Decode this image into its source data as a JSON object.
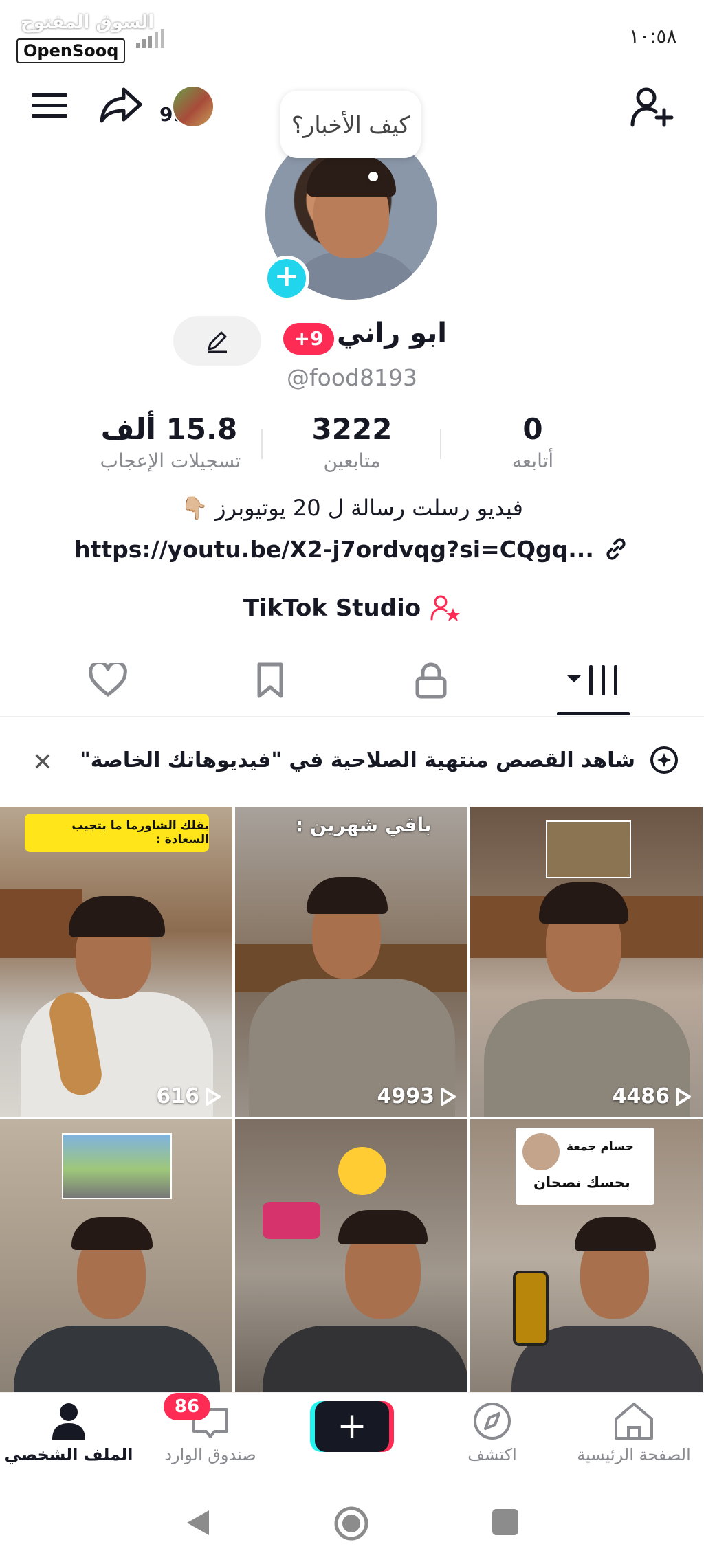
{
  "status_bar": {
    "time": "١٠:٥٨",
    "watermark_ar": "السوق المفتوح",
    "watermark": "OpenSooq"
  },
  "header": {
    "friends_count": "99"
  },
  "profile": {
    "bubble_text": "كيف الأخبار؟",
    "name": "ابو راني",
    "name_badge": "+9",
    "username": "@food8193",
    "stats": [
      {
        "value": "0",
        "label": "أتابعه"
      },
      {
        "value": "3222",
        "label": "متابعين"
      },
      {
        "value": "15.8 ألف",
        "label": "تسجيلات الإعجاب"
      }
    ],
    "bio": "فيديو رسلت رسالة ل 20 يوتيوبرز 👇🏼",
    "link": "https://youtu.be/X2-j7ordvqg?si=CQgq...",
    "studio": "TikTok Studio"
  },
  "banner": {
    "text": "شاهد القصص منتهية الصلاحية في \"فيديوهاتك الخاصة\""
  },
  "videos": [
    {
      "views": "4486",
      "sticker": ""
    },
    {
      "views": "4993",
      "sticker": "باقي شهرين :"
    },
    {
      "views": "616",
      "sticker": "بقلك الشاورما ما بتجيب السعادة :"
    },
    {
      "views": "",
      "sticker_name": "حسام جمعة",
      "sticker": "بحسك نصحان"
    },
    {
      "views": "",
      "sticker": ""
    },
    {
      "views": "",
      "sticker": ""
    }
  ],
  "bottom_nav": {
    "items": [
      {
        "label": "الصفحة الرئيسية",
        "icon": "home-icon"
      },
      {
        "label": "اكتشف",
        "icon": "compass-icon"
      },
      {
        "label": "",
        "icon": "plus-icon"
      },
      {
        "label": "صندوق الوارد",
        "icon": "inbox-icon"
      },
      {
        "label": "الملف الشخصي",
        "icon": "profile-icon"
      }
    ],
    "inbox_badge": "86"
  },
  "colors": {
    "accent_red": "#fe2c55",
    "accent_cyan": "#25f4ee",
    "text": "#161823"
  }
}
